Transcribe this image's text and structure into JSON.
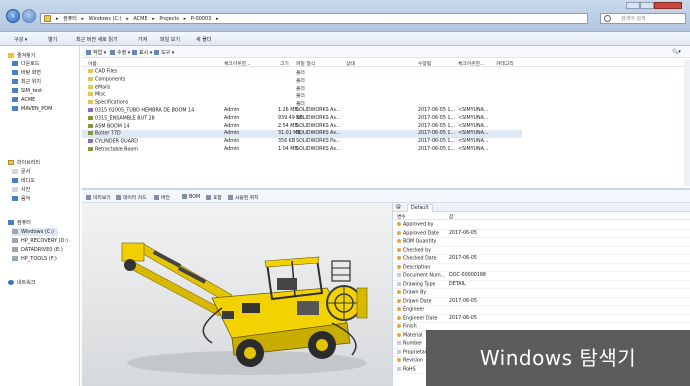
{
  "address": {
    "segments": [
      "컴퓨터",
      "Windows (C:)",
      "ACME",
      "Projects",
      "P-00003"
    ],
    "search_placeholder": "검색어 검색"
  },
  "command_bar": [
    "구성 ▾",
    "열기",
    "최근 버전 새로 읽기",
    "가져",
    "파일 보기",
    "새 폴더"
  ],
  "sidebar": {
    "favorites": [
      "즐겨찾기",
      "다운로드",
      "바탕 화면",
      "최근 위치",
      "SIM_test",
      "ACME",
      "MAVEN_PDM"
    ],
    "libraries": [
      "라이브러리",
      "문서",
      "비디오",
      "사진",
      "음악"
    ],
    "computer": [
      "컴퓨터",
      "Windows (C:)",
      "HP_RECOVERY (D:)",
      "DATADRIVE0 (E:)",
      "HP_TOOLS (F:)"
    ],
    "network": "네트워크"
  },
  "toolbar2": [
    "작업 ▾",
    "수정 ▾",
    "표시 ▾",
    "도구 ▾"
  ],
  "columns": [
    "이름",
    "체크아웃한...",
    "크기",
    "파일 형식",
    "상태",
    "수정됨",
    "체크아웃한...",
    "카테고리"
  ],
  "files": [
    {
      "name": "CAD Files",
      "kind": "folder",
      "user": "",
      "size": "",
      "type": "폴더",
      "date": "",
      "by": ""
    },
    {
      "name": "Components",
      "kind": "folder",
      "user": "",
      "size": "",
      "type": "폴더",
      "date": "",
      "by": ""
    },
    {
      "name": "eMails",
      "kind": "folder",
      "user": "",
      "size": "",
      "type": "폴더",
      "date": "",
      "by": ""
    },
    {
      "name": "Misc",
      "kind": "folder",
      "user": "",
      "size": "",
      "type": "폴더",
      "date": "",
      "by": ""
    },
    {
      "name": "Specifications",
      "kind": "folder",
      "user": "",
      "size": "",
      "type": "폴더",
      "date": "",
      "by": ""
    },
    {
      "name": "0315 0200S_TUBO HEMBRA DE BOOM 14",
      "kind": "part",
      "user": "Admin",
      "size": "1.26 MB",
      "type": "SOLIDWORKS As...",
      "date": "2017-06-05 1...",
      "by": "<SIMYUNA..."
    },
    {
      "name": "0315_ENSAMBLE BUT 28",
      "kind": "asm",
      "user": "Admin",
      "size": "939.49 KB",
      "type": "SOLIDWORKS As...",
      "date": "2017-06-05 1...",
      "by": "<SIMYUNA..."
    },
    {
      "name": "ASM BOOM 14",
      "kind": "asm",
      "user": "Admin",
      "size": "2.54 MB",
      "type": "SOLIDWORKS As...",
      "date": "2017-06-05 1...",
      "by": "<SIMYUNA..."
    },
    {
      "name": "Bolter 77D",
      "kind": "asm",
      "user": "Admin",
      "size": "31.01 MB",
      "type": "SOLIDWORKS As...",
      "date": "2017-06-05 1...",
      "by": "<SIMYUNA..."
    },
    {
      "name": "CYLINDER GUARD",
      "kind": "part",
      "user": "Admin",
      "size": "356 KB",
      "type": "SOLIDWORKS Pa...",
      "date": "2017-06-05 1...",
      "by": "<SIMYUNA..."
    },
    {
      "name": "Retractable Boom",
      "kind": "asm",
      "user": "Admin",
      "size": "1.04 MB",
      "type": "SOLIDWORKS As...",
      "date": "2017-06-05 1...",
      "by": "<SIMYUNA..."
    }
  ],
  "preview_tabs": [
    "미리보기",
    "데이터 카드",
    "버전",
    "BOM",
    "포함",
    "사용된 위치"
  ],
  "props": {
    "tabs": [
      "@",
      "Default"
    ],
    "headers": [
      "변수",
      "값"
    ],
    "rows": [
      {
        "k": "Approved by",
        "v": "",
        "filled": true
      },
      {
        "k": "Approved Date",
        "v": "2017-06-05",
        "filled": true
      },
      {
        "k": "BOM Quantity",
        "v": "",
        "filled": true
      },
      {
        "k": "Checked by",
        "v": "",
        "filled": true
      },
      {
        "k": "Checked Date",
        "v": "2017-06-05",
        "filled": true
      },
      {
        "k": "Description",
        "v": "",
        "filled": true
      },
      {
        "k": "Document Num...",
        "v": "DOC-00000188",
        "filled": false
      },
      {
        "k": "Drawing Type",
        "v": "DETAIL",
        "filled": false
      },
      {
        "k": "Drawn By",
        "v": "",
        "filled": true
      },
      {
        "k": "Drawn Date",
        "v": "2017-06-05",
        "filled": true
      },
      {
        "k": "Engineer",
        "v": "",
        "filled": true
      },
      {
        "k": "Engineer Date",
        "v": "2017-06-05",
        "filled": true
      },
      {
        "k": "Finish",
        "v": "",
        "filled": true
      },
      {
        "k": "Material",
        "v": "",
        "filled": true
      },
      {
        "k": "Number",
        "v": "",
        "filled": false
      },
      {
        "k": "Proprietar...",
        "v": "",
        "filled": false
      },
      {
        "k": "Revision",
        "v": "",
        "filled": true
      },
      {
        "k": "RoHS",
        "v": "",
        "filled": false
      }
    ]
  },
  "overlay_title": "Windows 탐색기"
}
